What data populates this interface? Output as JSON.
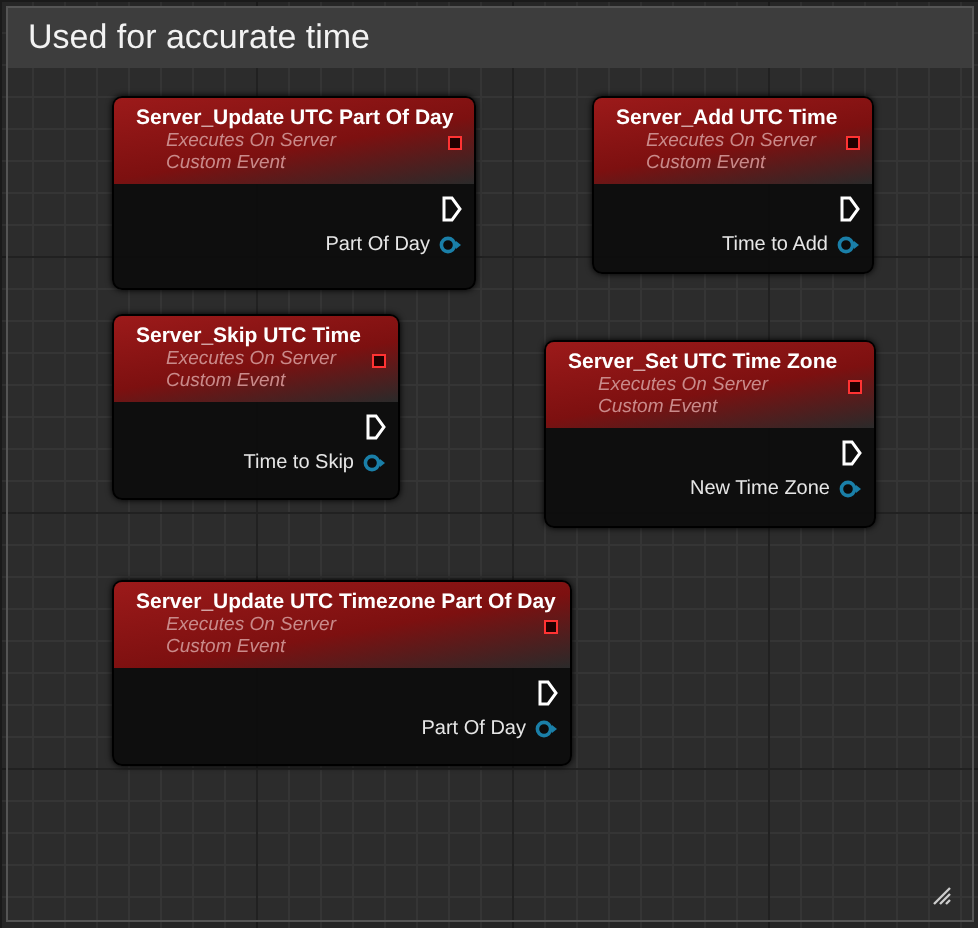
{
  "comment": {
    "title": "Used for accurate time"
  },
  "nodes": [
    {
      "title": "Server_Update UTC Part Of Day",
      "subtitle": [
        "Executes On Server",
        "Custom Event"
      ],
      "output_pin": "Part Of Day"
    },
    {
      "title": "Server_Add UTC Time",
      "subtitle": [
        "Executes On Server",
        "Custom Event"
      ],
      "output_pin": "Time to Add"
    },
    {
      "title": "Server_Skip UTC Time",
      "subtitle": [
        "Executes On Server",
        "Custom Event"
      ],
      "output_pin": "Time to Skip"
    },
    {
      "title": "Server_Set UTC Time Zone",
      "subtitle": [
        "Executes On Server",
        "Custom Event"
      ],
      "output_pin": "New Time Zone"
    },
    {
      "title": "Server_Update UTC Timezone Part Of Day",
      "subtitle": [
        "Executes On Server",
        "Custom Event"
      ],
      "output_pin": "Part Of Day"
    }
  ]
}
